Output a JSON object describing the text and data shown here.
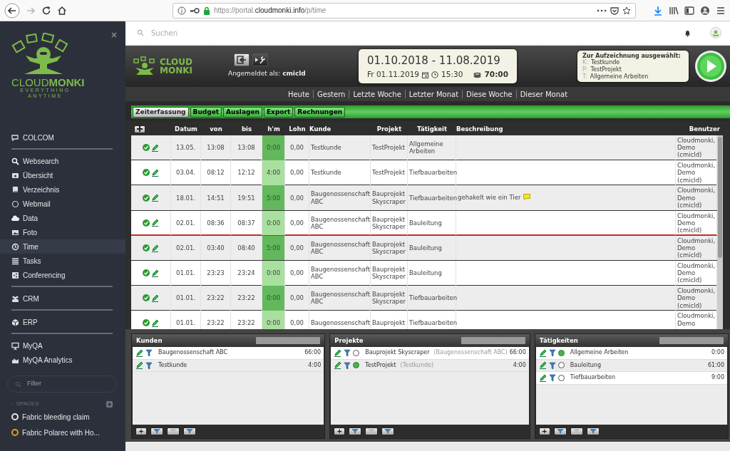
{
  "browser": {
    "url": "https://portal.**cloudmonki.info**/p/time",
    "forward_disabled": true
  },
  "sidebar": {
    "logo": {
      "name": "CLOUD**MONKI**",
      "tagline": [
        "EVERYTHING",
        "ANYTIME"
      ]
    },
    "groups": [
      [
        {
          "label": "COLCOM",
          "selected": false
        }
      ],
      [
        {
          "label": "Websearch",
          "selected": false
        },
        {
          "label": "Übersicht",
          "selected": false
        },
        {
          "label": "Verzeichnis",
          "selected": false
        },
        {
          "label": "Webmail",
          "selected": false
        },
        {
          "label": "Data",
          "selected": false
        },
        {
          "label": "Foto",
          "selected": false
        },
        {
          "label": "Time",
          "selected": true
        },
        {
          "label": "Tasks",
          "selected": false
        },
        {
          "label": "Conferencing",
          "selected": false
        }
      ],
      [
        {
          "label": "CRM",
          "selected": false
        }
      ],
      [
        {
          "label": "ERP",
          "selected": false
        }
      ],
      [
        {
          "label": "MyQA",
          "selected": false
        },
        {
          "label": "MyQA Analytics",
          "selected": false
        }
      ]
    ],
    "filter": {
      "placeholder": "Filter"
    },
    "spaces": {
      "toggle": "-",
      "title": "SPACES",
      "items": [
        {
          "label": "Fabric bleeding claim",
          "color": "#e8e8e8"
        },
        {
          "label": "Fabric Polarec with Ho...",
          "color": "#d9a21b"
        }
      ]
    }
  },
  "topbar": {
    "search": {
      "placeholder": "Suchen"
    }
  },
  "header": {
    "logo": [
      "CLOUD",
      "MONKI"
    ],
    "login": "Angemeldet als: **cmicld**",
    "range": "01.10.2018 - 11.08.2019",
    "date": "Fr 01.11.2019",
    "time": "15:30",
    "total": "70:00",
    "selection": {
      "title": "Zur Aufzeichnung ausgewählt:",
      "lines": [
        {
          "prefix": "K:",
          "value": "Testkunde"
        },
        {
          "prefix": "P:",
          "value": "TestProjekt"
        },
        {
          "prefix": "T:",
          "value": "Allgemeine Arbeiten"
        }
      ]
    }
  },
  "quick_ranges": [
    "Heute",
    "Gestern",
    "Letzte Woche",
    "Letzter Monat",
    "Diese Woche",
    "Dieser Monat"
  ],
  "tabs": [
    {
      "label": "Zeiterfassung",
      "selected": true
    },
    {
      "label": "Budget",
      "selected": false
    },
    {
      "label": "Auslagen",
      "selected": false
    },
    {
      "label": "Export",
      "selected": false
    },
    {
      "label": "Rechnungen",
      "selected": false
    }
  ],
  "table": {
    "columns": [
      "Datum",
      "von",
      "bis",
      "h'm",
      "Lohn",
      "Kunde",
      "Projekt",
      "Tätigkeit",
      "Beschreibung",
      "Benutzer"
    ],
    "rows": [
      {
        "datum": "13.05.",
        "von": "13:08",
        "bis": "13:08",
        "hm": "0:00",
        "lohn": "0,00",
        "kunde": "Testkunde",
        "projekt": "TestProjekt",
        "taetigkeit": "Allgemeine Arbeiten",
        "benutzer": "Cloudmonki, Demo (cmicld)",
        "comment": false,
        "marker_below": false
      },
      {
        "datum": "03.04.",
        "von": "08:12",
        "bis": "12:12",
        "hm": "4:00",
        "lohn": "0,00",
        "kunde": "Testkunde",
        "projekt": "TestProjekt",
        "taetigkeit": "Tiefbauarbeiten",
        "benutzer": "Cloudmonki, Demo (cmicld)",
        "comment": false,
        "marker_below": false
      },
      {
        "datum": "18.01.",
        "von": "14:51",
        "bis": "19:51",
        "hm": "5:00",
        "lohn": "0,00",
        "kunde": "Baugenossenschaft ABC",
        "projekt": "Bauprojekt Skyscraper",
        "taetigkeit": "Tiefbauarbeiten",
        "beschreibung": "gehakelt wie ein Tier",
        "benutzer": "Cloudmonki, Demo (cmicld)",
        "comment": true,
        "marker_below": false
      },
      {
        "datum": "02.01.",
        "von": "08:36",
        "bis": "08:37",
        "hm": "0:00",
        "lohn": "0,00",
        "kunde": "Baugenossenschaft ABC",
        "projekt": "Bauprojekt Skyscraper",
        "taetigkeit": "Bauleitung",
        "benutzer": "Cloudmonki, Demo (cmicld)",
        "comment": false,
        "marker_below": true
      },
      {
        "datum": "02.01.",
        "von": "03:40",
        "bis": "08:40",
        "hm": "5:00",
        "lohn": "0,00",
        "kunde": "Baugenossenschaft ABC",
        "projekt": "Bauprojekt Skyscraper",
        "taetigkeit": "Bauleitung",
        "benutzer": "Cloudmonki, Demo (cmicld)",
        "comment": false,
        "marker_below": false
      },
      {
        "datum": "01.01.",
        "von": "23:23",
        "bis": "23:24",
        "hm": "0:00",
        "lohn": "0,00",
        "kunde": "Baugenossenschaft ABC",
        "projekt": "Bauprojekt Skyscraper",
        "taetigkeit": "Bauleitung",
        "benutzer": "Cloudmonki, Demo (cmicld)",
        "comment": false,
        "marker_below": false
      },
      {
        "datum": "01.01.",
        "von": "23:22",
        "bis": "23:22",
        "hm": "0:00",
        "lohn": "0,00",
        "kunde": "Baugenossenschaft ABC",
        "projekt": "Bauprojekt Skyscraper",
        "taetigkeit": "Tiefbauarbeiten",
        "benutzer": "Cloudmonki, Demo (cmicld)",
        "comment": false,
        "marker_below": false
      },
      {
        "datum": "01.01.",
        "von": "23:22",
        "bis": "23:22",
        "hm": "0:00",
        "lohn": "0,00",
        "kunde": "Baugenossenschaft",
        "projekt": "Bauprojekt",
        "taetigkeit": "Tiefbauarbeiten",
        "benutzer": "Cloudmonki, Demo",
        "comment": false,
        "marker_below": false
      }
    ]
  },
  "panels": [
    {
      "title": "Kunden",
      "kind": "plain",
      "items": [
        {
          "name": "Baugenossenschaft ABC",
          "hours": "66:00"
        },
        {
          "name": "Testkunde",
          "hours": "4:00"
        }
      ]
    },
    {
      "title": "Projekte",
      "kind": "radio",
      "items": [
        {
          "name": "Bauprojekt Skyscraper",
          "client": "(Baugenossenschaft ABC)",
          "hours": "66:00",
          "selected": false
        },
        {
          "name": "TestProjekt",
          "client": "(Testkunde)",
          "hours": "4:00",
          "selected": true
        }
      ]
    },
    {
      "title": "Tätigkeiten",
      "kind": "radio",
      "items": [
        {
          "name": "Allgemeine Arbeiten",
          "hours": "0:00",
          "selected": true
        },
        {
          "name": "Bauleitung",
          "hours": "61:00",
          "selected": false
        },
        {
          "name": "Tiefbauarbeiten",
          "hours": "9:00",
          "selected": false
        }
      ]
    }
  ],
  "panel_add": "+"
}
